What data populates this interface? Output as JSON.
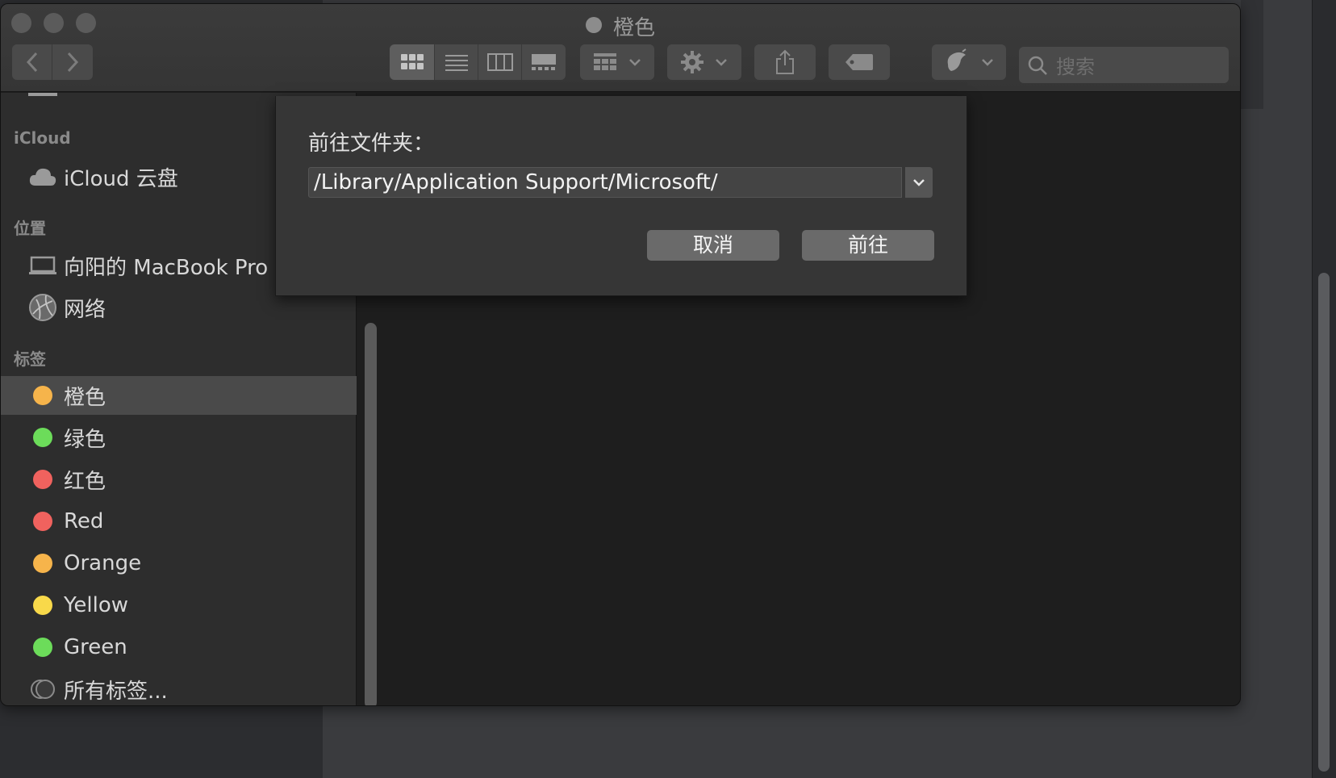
{
  "window": {
    "title": "橙色"
  },
  "search": {
    "placeholder": "搜索"
  },
  "sidebar": {
    "sections": {
      "icloud": "iCloud",
      "locations": "位置",
      "tags": "标签"
    },
    "icloud_items": [
      {
        "label": "iCloud 云盘",
        "icon": "cloud-icon"
      }
    ],
    "location_items": [
      {
        "label": "向阳的 MacBook Pro",
        "icon": "laptop-icon"
      },
      {
        "label": "网络",
        "icon": "network-globe-icon"
      }
    ],
    "tag_items": [
      {
        "label": "橙色",
        "color": "#f6b44b",
        "selected": true
      },
      {
        "label": "绿色",
        "color": "#6cdc5a"
      },
      {
        "label": "红色",
        "color": "#f0625e"
      },
      {
        "label": "Red",
        "color": "#f0625e"
      },
      {
        "label": "Orange",
        "color": "#f6b44b"
      },
      {
        "label": "Yellow",
        "color": "#f8d94a"
      },
      {
        "label": "Green",
        "color": "#6cdc5a"
      }
    ],
    "all_tags": "所有标签..."
  },
  "dialog": {
    "label": "前往文件夹：",
    "path_value": "/Library/Application Support/Microsoft/",
    "cancel_label": "取消",
    "go_label": "前往"
  },
  "colors": {
    "orange": "#f6b44b",
    "green": "#6cdc5a",
    "red": "#f0625e",
    "yellow": "#f8d94a"
  }
}
